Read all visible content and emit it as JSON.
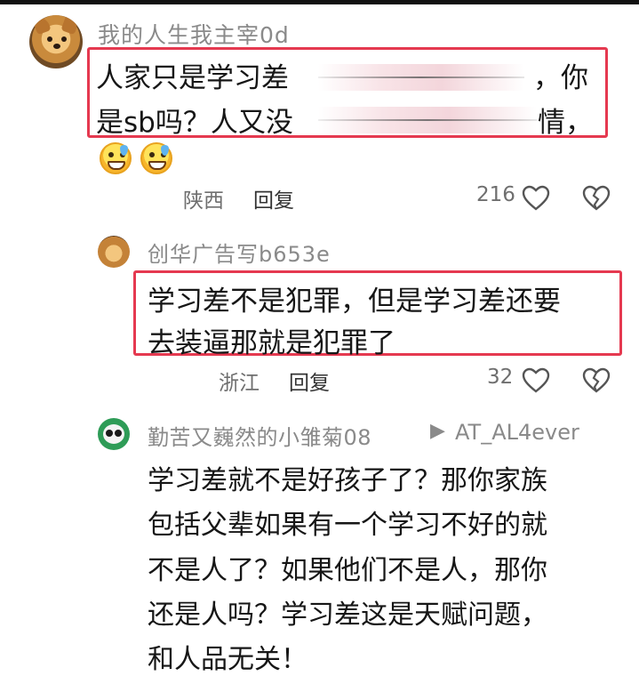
{
  "comment1": {
    "username": "我的人生我主宰0d",
    "line1_start": "人家只是学习差",
    "line1_end": "，你",
    "line2_start": "是sb吗？人又没",
    "line2_end": "情，",
    "location": "陕西",
    "reply_label": "回复",
    "likes": "216"
  },
  "comment2": {
    "username": "创华广告写b653e",
    "line1": "学习差不是犯罪，但是学习差还要",
    "line2": "去装逼那就是犯罪了",
    "location": "浙江",
    "reply_label": "回复",
    "likes": "32"
  },
  "comment3": {
    "username": "勤苦又巍然的小雏菊08",
    "reply_arrow": "▶",
    "reply_to": "AT_AL4ever",
    "lines": [
      "学习差就不是好孩子了？那你家族",
      "包括父辈如果有一个学习不好的就",
      "不是人了？如果他们不是人，那你",
      "还是人吗？学习差这是天赋问题，",
      "和人品无关！"
    ]
  },
  "icons": {
    "like": "heart-outline-icon",
    "dislike": "broken-heart-icon",
    "emoji": "sweat-grin-emoji-icon"
  },
  "colors": {
    "highlight_box": "#e53950",
    "username": "#8a8a8a",
    "meta": "#6f6f6f"
  }
}
